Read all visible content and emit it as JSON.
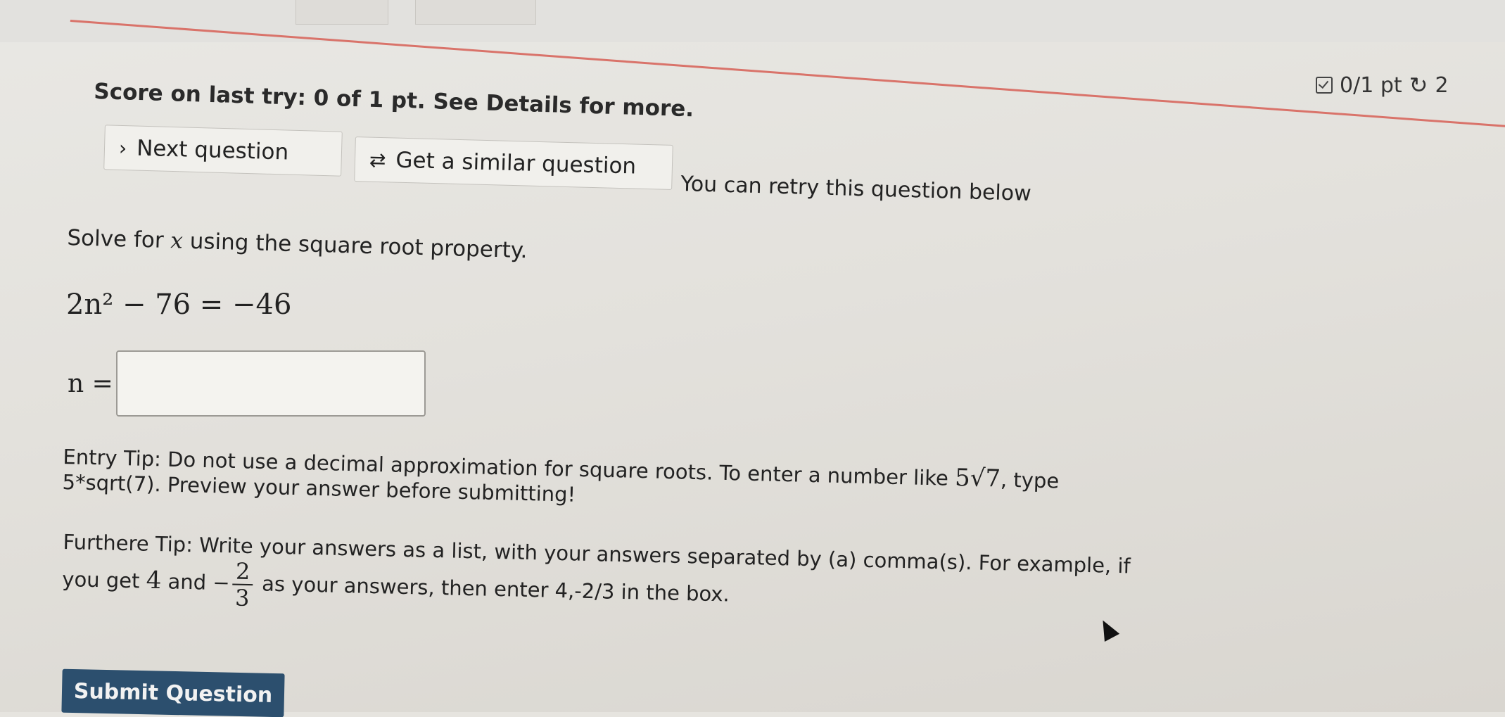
{
  "score": {
    "points": "0/1 pt",
    "retries_left": "2",
    "last_try": "Score on last try: 0 of 1 pt. See Details for more."
  },
  "actions": {
    "next_label": "Next question",
    "similar_label": "Get a similar question",
    "retry_note": "You can retry this question below"
  },
  "question": {
    "prompt_before": "Solve for",
    "prompt_var": "x",
    "prompt_after": "using the square root property.",
    "equation": "2n² − 76 = −46",
    "answer_label": "n =",
    "answer_value": ""
  },
  "tips": {
    "entry_tip_a": "Entry Tip: Do not use a decimal approximation for square roots. To enter a number like",
    "entry_tip_math": "5√7",
    "entry_tip_b": ", type 5*sqrt(7). Preview your answer before submitting!",
    "further_tip_a": "Furthere Tip: Write your answers as a list, with your answers separated by (a) comma(s). For example, if you get",
    "further_tip_4": "4",
    "further_tip_and": "and",
    "further_tip_minus": "−",
    "frac_num": "2",
    "frac_den": "3",
    "further_tip_b": "as your answers, then enter 4,-2/3 in the box."
  },
  "submit_label": "Submit Question"
}
